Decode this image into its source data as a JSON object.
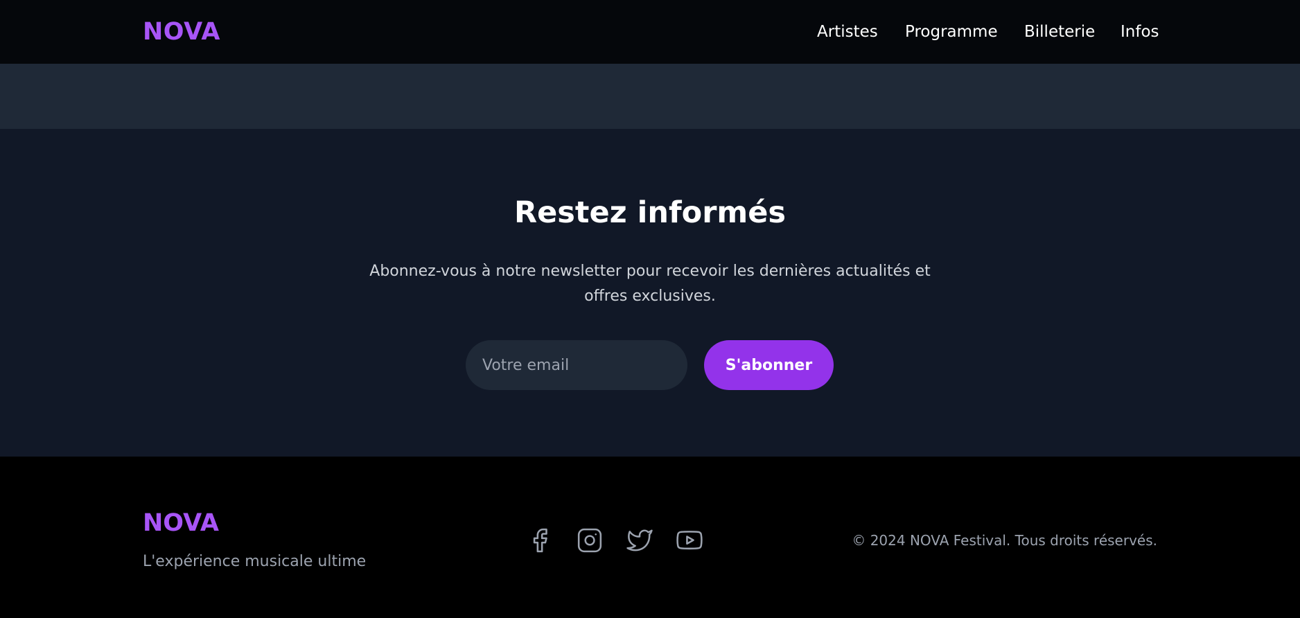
{
  "header": {
    "logo": "NOVA",
    "nav": [
      "Artistes",
      "Programme",
      "Billeterie",
      "Infos"
    ]
  },
  "newsletter": {
    "title": "Restez informés",
    "description": "Abonnez-vous à notre newsletter pour recevoir les dernières actualités et offres exclusives.",
    "email_placeholder": "Votre email",
    "subscribe_label": "S'abonner"
  },
  "footer": {
    "logo": "NOVA",
    "tagline": "L'expérience musicale ultime",
    "social_icons": [
      "facebook-icon",
      "instagram-icon",
      "twitter-icon",
      "youtube-icon"
    ],
    "copyright": "© 2024 NOVA Festival. Tous droits réservés."
  },
  "colors": {
    "accent": "#a855f7",
    "button": "#9333ea",
    "header_bg": "#05070b",
    "band_bg": "#1f2937",
    "newsletter_bg": "#111827",
    "footer_bg": "#000000"
  }
}
